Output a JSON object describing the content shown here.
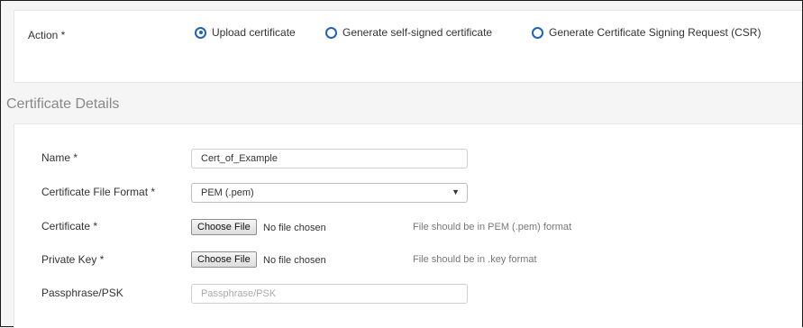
{
  "action": {
    "label": "Action *",
    "options": [
      {
        "label": "Upload certificate",
        "selected": true
      },
      {
        "label": "Generate self-signed certificate",
        "selected": false
      },
      {
        "label": "Generate Certificate Signing Request (CSR)",
        "selected": false
      }
    ]
  },
  "details": {
    "title": "Certificate Details",
    "name": {
      "label": "Name *",
      "value": "Cert_of_Example"
    },
    "format": {
      "label": "Certificate File Format *",
      "value": "PEM (.pem)"
    },
    "certificate": {
      "label": "Certificate *",
      "button": "Choose File",
      "status": "No file chosen",
      "hint": "File should be in PEM (.pem) format"
    },
    "private_key": {
      "label": "Private Key *",
      "button": "Choose File",
      "status": "No file chosen",
      "hint": "File should be in .key format"
    },
    "passphrase": {
      "label": "Passphrase/PSK",
      "placeholder": "Passphrase/PSK"
    }
  },
  "colors": {
    "accent": "#1f63b6",
    "panel_border": "#e6e6e6",
    "background": "#f5f5f5"
  }
}
